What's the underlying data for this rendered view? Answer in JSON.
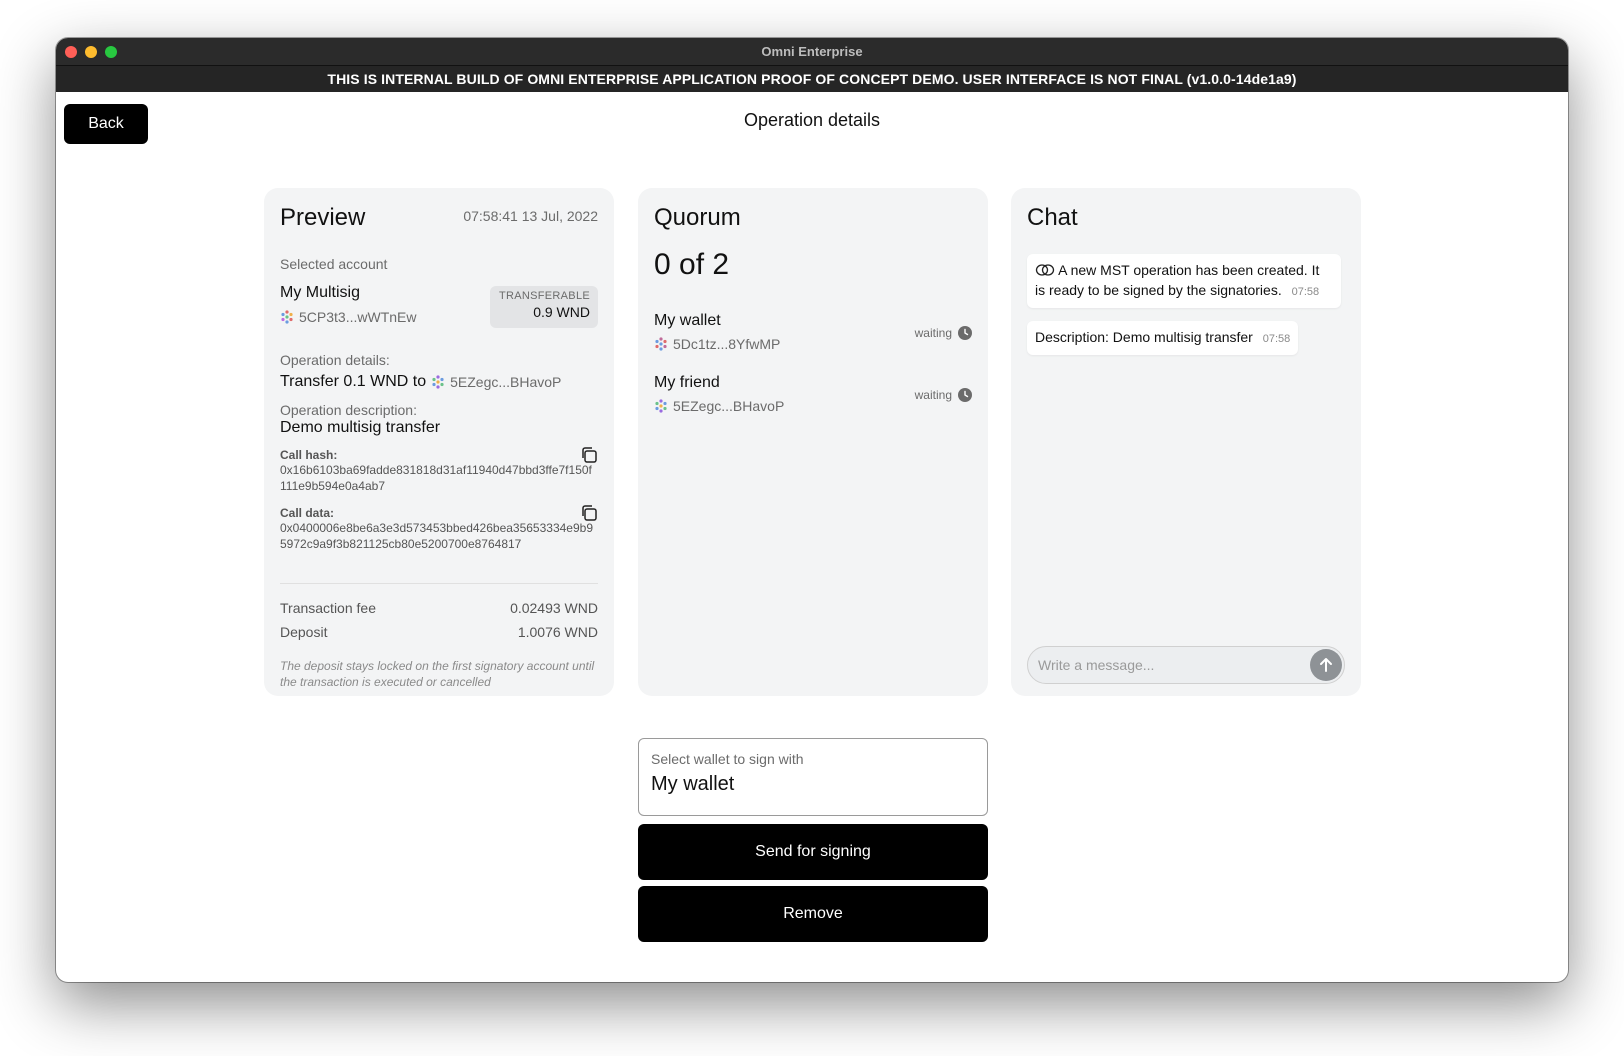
{
  "window": {
    "title": "Omni Enterprise",
    "banner": "THIS IS INTERNAL BUILD OF OMNI ENTERPRISE APPLICATION PROOF OF CONCEPT DEMO. USER INTERFACE IS NOT FINAL (v1.0.0-14de1a9)"
  },
  "header": {
    "back_label": "Back",
    "page_title": "Operation details"
  },
  "preview": {
    "title": "Preview",
    "date": "07:58:41 13 Jul, 2022",
    "selected_account_label": "Selected account",
    "account_name": "My Multisig",
    "account_address": "5CP3t3...wWTnEw",
    "transferable_label": "TRANSFERABLE",
    "transferable_value": "0.9 WND",
    "operation_details_label": "Operation details:",
    "operation_details_value": "Transfer 0.1 WND to",
    "operation_recipient": "5EZegc...BHavoP",
    "operation_description_label": "Operation description:",
    "operation_description_value": "Demo multisig transfer",
    "call_hash_label": "Call hash:",
    "call_hash_value": "0x16b6103ba69fadde831818d31af11940d47bbd3ffe7f150f111e9b594e0a4ab7",
    "call_data_label": "Call data:",
    "call_data_value": "0x0400006e8be6a3e3d573453bbed426bea35653334e9b95972c9a9f3b821125cb80e5200700e8764817",
    "fee_label": "Transaction fee",
    "fee_value": "0.02493 WND",
    "deposit_label": "Deposit",
    "deposit_value": "1.0076 WND",
    "deposit_note": "The deposit stays locked on the first signatory account until the transaction is executed or cancelled"
  },
  "quorum": {
    "title": "Quorum",
    "count": "0 of 2",
    "signers": [
      {
        "name": "My wallet",
        "address": "5Dc1tz...8YfwMP",
        "status": "waiting"
      },
      {
        "name": "My friend",
        "address": "5EZegc...BHavoP",
        "status": "waiting"
      }
    ]
  },
  "chat": {
    "title": "Chat",
    "messages": [
      {
        "text": "A new MST operation has been created. It is ready to be signed by the signatories.",
        "time": "07:58"
      },
      {
        "text": "Description: Demo multisig transfer",
        "time": "07:58"
      }
    ],
    "input_placeholder": "Write a message..."
  },
  "signing": {
    "select_label": "Select wallet to sign with",
    "selected_wallet": "My wallet",
    "send_label": "Send for signing",
    "remove_label": "Remove"
  },
  "colors": {
    "accent": "#000000",
    "card_bg": "#f3f4f5",
    "titlebar": "#2b2b2b"
  }
}
